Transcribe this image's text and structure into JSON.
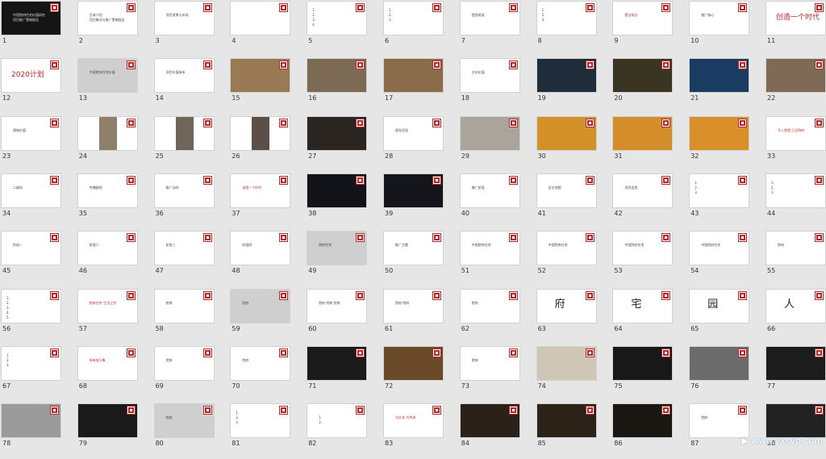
{
  "viewer": {
    "columns": 11,
    "selected_slide": 1,
    "slides": [
      {
        "n": "1",
        "type": "dark-title",
        "lines": [
          "中国院府住宅价值研究",
          "项目推广策略报告"
        ]
      },
      {
        "n": "2",
        "type": "text",
        "lines": [
          "目录介绍",
          "项目概况与推广策略报告"
        ]
      },
      {
        "n": "3",
        "type": "text",
        "lines": [
          "项目背景与市场"
        ]
      },
      {
        "n": "4",
        "type": "table",
        "lines": []
      },
      {
        "n": "5",
        "type": "text",
        "lines": [
          "1.",
          "2.",
          "3.",
          "4."
        ]
      },
      {
        "n": "6",
        "type": "text",
        "lines": [
          "1.",
          "2.",
          "3."
        ]
      },
      {
        "n": "7",
        "type": "text",
        "lines": [
          "提案框架"
        ]
      },
      {
        "n": "8",
        "type": "text",
        "lines": [
          "1.",
          "2.",
          "3."
        ]
      },
      {
        "n": "9",
        "type": "red-text",
        "lines": [
          "提出观点"
        ]
      },
      {
        "n": "10",
        "type": "text",
        "lines": [
          "推广核心"
        ]
      },
      {
        "n": "11",
        "type": "big",
        "text": "创造一个时代"
      },
      {
        "n": "12",
        "type": "big",
        "text": "2020计划"
      },
      {
        "n": "13",
        "type": "grey",
        "lines": [
          "中国院府住宅价值"
        ]
      },
      {
        "n": "14",
        "type": "text",
        "lines": [
          "项目价值体系"
        ]
      },
      {
        "n": "15",
        "type": "img",
        "bg": "#9a7a55"
      },
      {
        "n": "16",
        "type": "img",
        "bg": "#7c6a55"
      },
      {
        "n": "17",
        "type": "img",
        "bg": "#8a6c4a"
      },
      {
        "n": "18",
        "type": "text",
        "lines": [
          "文化价值"
        ]
      },
      {
        "n": "19",
        "type": "img",
        "bg": "#1f2c3a"
      },
      {
        "n": "20",
        "type": "img",
        "bg": "#3a3522"
      },
      {
        "n": "21",
        "type": "img",
        "bg": "#1b3c62"
      },
      {
        "n": "22",
        "type": "img",
        "bg": "#7f6a55"
      },
      {
        "n": "23",
        "type": "text",
        "lines": [
          "建筑价值"
        ]
      },
      {
        "n": "24",
        "type": "img-mid",
        "bg": "#8e7f6a"
      },
      {
        "n": "25",
        "type": "img-mid",
        "bg": "#6f6558"
      },
      {
        "n": "26",
        "type": "img-mid",
        "bg": "#5a5048"
      },
      {
        "n": "27",
        "type": "img",
        "bg": "#2a2520"
      },
      {
        "n": "28",
        "type": "text",
        "lines": [
          "视觉呈现"
        ]
      },
      {
        "n": "29",
        "type": "img",
        "bg": "#aaa49a"
      },
      {
        "n": "30",
        "type": "img",
        "bg": "#d4912a"
      },
      {
        "n": "31",
        "type": "img",
        "bg": "#d48d29"
      },
      {
        "n": "32",
        "type": "img",
        "bg": "#d98f2a"
      },
      {
        "n": "33",
        "type": "red-text",
        "lines": [
          "不入院墙 已见院府"
        ]
      },
      {
        "n": "34",
        "type": "text",
        "lines": [
          "二维码"
        ]
      },
      {
        "n": "35",
        "type": "text",
        "lines": [
          "传播路径"
        ]
      },
      {
        "n": "36",
        "type": "text",
        "lines": [
          "推广动作"
        ]
      },
      {
        "n": "37",
        "type": "red-text",
        "lines": [
          "创造一个时代"
        ]
      },
      {
        "n": "38",
        "type": "img",
        "bg": "#111319"
      },
      {
        "n": "39",
        "type": "img",
        "bg": "#14161c"
      },
      {
        "n": "40",
        "type": "text",
        "lines": [
          "推广阶段"
        ]
      },
      {
        "n": "41",
        "type": "text",
        "lines": [
          "区位地图"
        ]
      },
      {
        "n": "42",
        "type": "text",
        "lines": [
          "项目信息"
        ]
      },
      {
        "n": "43",
        "type": "text",
        "lines": [
          "1.",
          "2.",
          "3."
        ]
      },
      {
        "n": "44",
        "type": "text",
        "lines": [
          "1.",
          "2.",
          "3."
        ]
      },
      {
        "n": "45",
        "type": "text",
        "lines": [
          "阶段一"
        ]
      },
      {
        "n": "46",
        "type": "text",
        "lines": [
          "阶段二"
        ]
      },
      {
        "n": "47",
        "type": "text",
        "lines": [
          "阶段三"
        ]
      },
      {
        "n": "48",
        "type": "text",
        "lines": [
          "阶段四"
        ]
      },
      {
        "n": "49",
        "type": "grey",
        "lines": [
          "院府住宅"
        ]
      },
      {
        "n": "50",
        "type": "text",
        "lines": [
          "推广主题"
        ]
      },
      {
        "n": "51",
        "type": "text",
        "lines": [
          "中国院府住宅"
        ]
      },
      {
        "n": "52",
        "type": "text",
        "lines": [
          "中国院府住宅"
        ]
      },
      {
        "n": "53",
        "type": "text",
        "lines": [
          "中国院府住宅"
        ]
      },
      {
        "n": "54",
        "type": "text",
        "lines": [
          "中国院府住宅"
        ]
      },
      {
        "n": "55",
        "type": "text",
        "lines": [
          "院府"
        ]
      },
      {
        "n": "56",
        "type": "text",
        "lines": [
          "1.",
          "2.",
          "3.",
          "4.",
          "5."
        ]
      },
      {
        "n": "57",
        "type": "red-text",
        "lines": [
          "院府住宅 生活之宗"
        ]
      },
      {
        "n": "58",
        "type": "text",
        "lines": [
          "院府"
        ]
      },
      {
        "n": "59",
        "type": "grey",
        "lines": [
          "院府"
        ]
      },
      {
        "n": "60",
        "type": "text",
        "lines": [
          "院府 院府 院府"
        ]
      },
      {
        "n": "61",
        "type": "text",
        "lines": [
          "院府 院府"
        ]
      },
      {
        "n": "62",
        "type": "text",
        "lines": [
          "院府"
        ]
      },
      {
        "n": "63",
        "type": "big-dark",
        "text": "府"
      },
      {
        "n": "64",
        "type": "big-dark",
        "text": "宅"
      },
      {
        "n": "65",
        "type": "big-dark",
        "text": "园"
      },
      {
        "n": "66",
        "type": "big-dark",
        "text": "人"
      },
      {
        "n": "67",
        "type": "text",
        "lines": [
          "1.",
          "2.",
          "3."
        ]
      },
      {
        "n": "68",
        "type": "red-text",
        "lines": [
          "所有皆万象"
        ]
      },
      {
        "n": "69",
        "type": "text",
        "lines": [
          "院府"
        ]
      },
      {
        "n": "70",
        "type": "text",
        "lines": [
          "院府"
        ]
      },
      {
        "n": "71",
        "type": "img",
        "bg": "#1a1a1a"
      },
      {
        "n": "72",
        "type": "img",
        "bg": "#6b4a2a"
      },
      {
        "n": "73",
        "type": "text",
        "lines": [
          "院府"
        ]
      },
      {
        "n": "74",
        "type": "img",
        "bg": "#cfc6b8"
      },
      {
        "n": "75",
        "type": "img",
        "bg": "#181818"
      },
      {
        "n": "76",
        "type": "img",
        "bg": "#6b6b6b"
      },
      {
        "n": "77",
        "type": "img",
        "bg": "#1c1c1c"
      },
      {
        "n": "78",
        "type": "img",
        "bg": "#9b9b9b"
      },
      {
        "n": "79",
        "type": "img",
        "bg": "#1a1a1a"
      },
      {
        "n": "80",
        "type": "grey",
        "lines": [
          "院府"
        ]
      },
      {
        "n": "81",
        "type": "text",
        "lines": [
          "1.",
          "2.",
          "3."
        ]
      },
      {
        "n": "82",
        "type": "text",
        "lines": [
          "1.",
          "2."
        ]
      },
      {
        "n": "83",
        "type": "red-text",
        "lines": [
          "为红本 为传承"
        ]
      },
      {
        "n": "84",
        "type": "img",
        "bg": "#2a2118"
      },
      {
        "n": "85",
        "type": "img",
        "bg": "#2b2218"
      },
      {
        "n": "86",
        "type": "img",
        "bg": "#1a1712"
      },
      {
        "n": "87",
        "type": "text",
        "lines": [
          "院府"
        ]
      },
      {
        "n": "88",
        "type": "img",
        "bg": "#222222"
      }
    ]
  },
  "watermark": "▶ www.yxsvp.com",
  "colors": {
    "brand": "#b42a2a",
    "background": "#e6e6e6"
  }
}
